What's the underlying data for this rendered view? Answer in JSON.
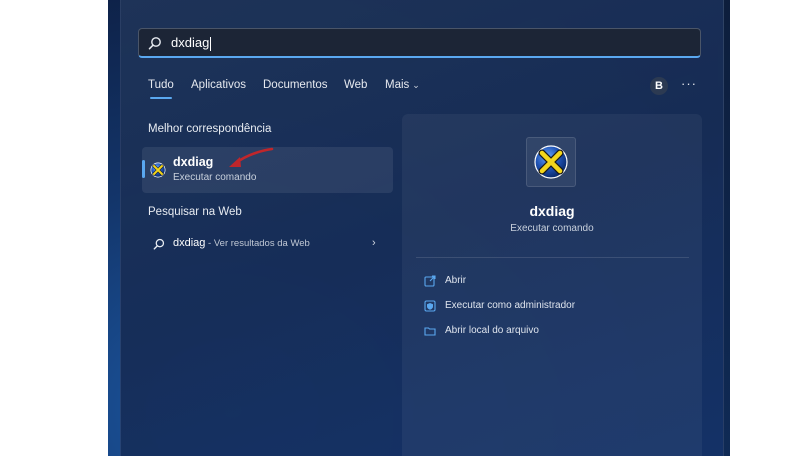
{
  "search": {
    "query": "dxdiag"
  },
  "tabs": [
    {
      "label": "Tudo"
    },
    {
      "label": "Aplicativos"
    },
    {
      "label": "Documentos"
    },
    {
      "label": "Web"
    },
    {
      "label": "Mais"
    }
  ],
  "account": {
    "initial": "B"
  },
  "more_label": "···",
  "best_match": {
    "section_title": "Melhor correspondência",
    "name": "dxdiag",
    "subtitle": "Executar comando"
  },
  "web_search": {
    "section_title": "Pesquisar na Web",
    "query": "dxdiag",
    "suffix": " - Ver resultados da Web"
  },
  "detail": {
    "name": "dxdiag",
    "subtitle": "Executar comando",
    "actions": [
      {
        "label": "Abrir",
        "icon": "open-icon"
      },
      {
        "label": "Executar como administrador",
        "icon": "admin-shield-icon"
      },
      {
        "label": "Abrir local do arquivo",
        "icon": "folder-icon"
      }
    ]
  },
  "colors": {
    "accent": "#5aa8f0",
    "annotation_arrow": "#c0262b"
  }
}
